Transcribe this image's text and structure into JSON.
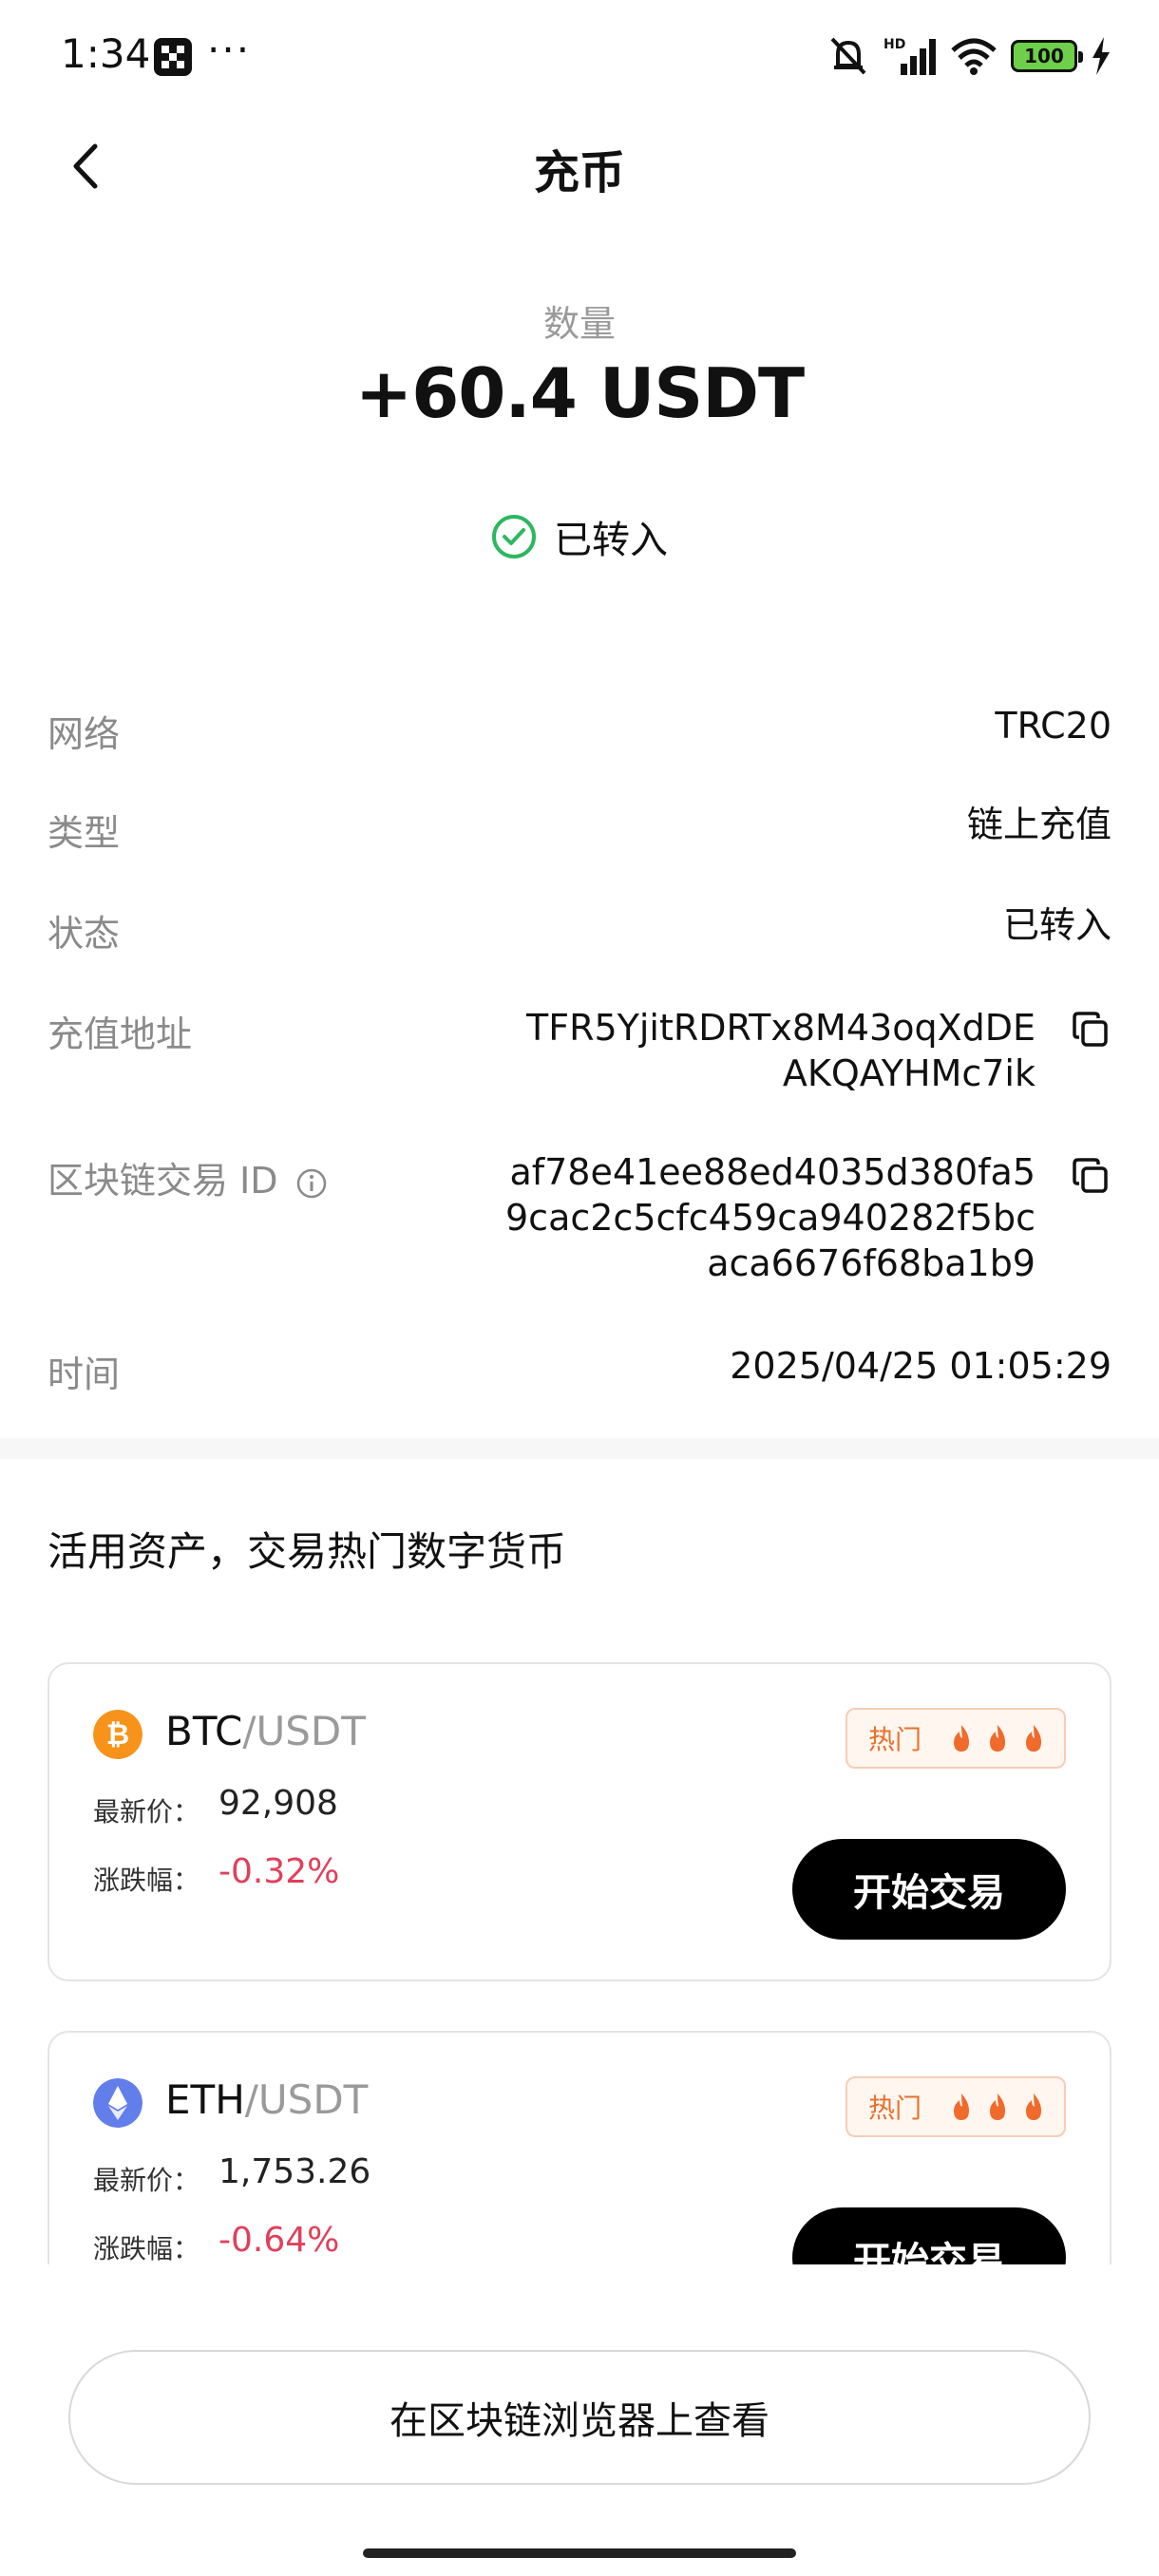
{
  "status_bar": {
    "time": "1:34",
    "dots": "···",
    "battery": "100",
    "icons": [
      "app-icon",
      "mute-icon",
      "hd-signal-icon",
      "wifi-icon",
      "battery-icon",
      "charging-icon"
    ]
  },
  "nav": {
    "title": "充币",
    "back_icon": "chevron-left-icon"
  },
  "summary": {
    "qty_label": "数量",
    "qty_value": "+60.4 USDT",
    "status_text": "已转入",
    "status_color": "#2db760"
  },
  "details": {
    "network": {
      "label": "网络",
      "value": "TRC20"
    },
    "type": {
      "label": "类型",
      "value": "链上充值"
    },
    "state": {
      "label": "状态",
      "value": "已转入"
    },
    "address": {
      "label": "充值地址",
      "value": "TFR5YjitRDRTx8M43oqXdDEAKQAYHMc7ik"
    },
    "txid": {
      "label": "区块链交易 ID",
      "value": "af78e41ee88ed4035d380fa59cac2c5cfc459ca940282f5bcaca6676f68ba1b9"
    },
    "time": {
      "label": "时间",
      "value": "2025/04/25 01:05:29"
    }
  },
  "promo": {
    "title": "活用资产，交易热门数字货币",
    "price_label": "最新价：",
    "change_label": "涨跌幅：",
    "hot_label": "热门",
    "trade_label": "开始交易",
    "cards": [
      {
        "base": "BTC",
        "quote": "/USDT",
        "price": "92,908",
        "change": "-0.32%",
        "icon_color": "#f7931a"
      },
      {
        "base": "ETH",
        "quote": "/USDT",
        "price": "1,753.26",
        "change": "-0.64%",
        "icon_color": "#627eea"
      }
    ]
  },
  "footer": {
    "explorer_label": "在区块链浏览器上查看"
  },
  "colors": {
    "negative": "#e0405a",
    "hot": "#e8702a",
    "button": "#000000"
  }
}
